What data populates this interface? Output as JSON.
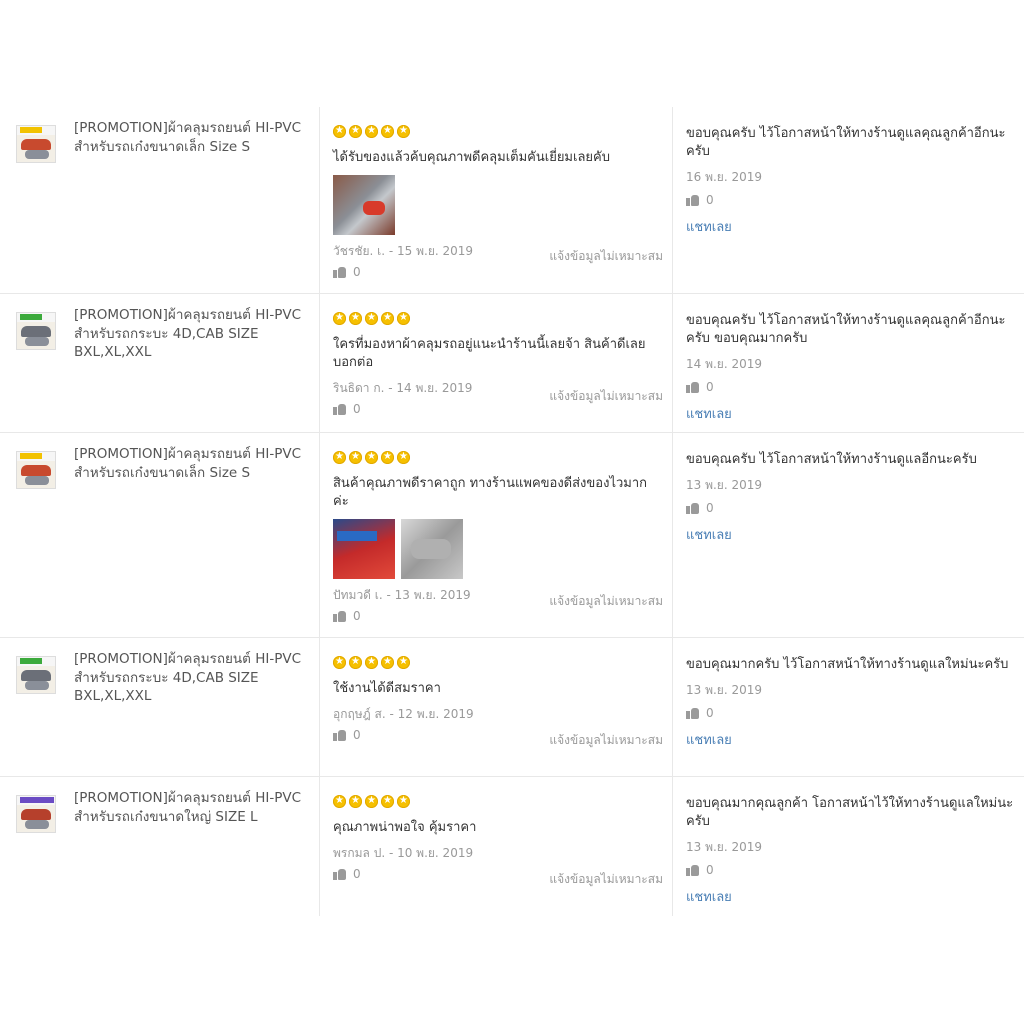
{
  "report_label": "แจ้งข้อมูลไม่เหมาะสม",
  "chat_label": "แชทเลย",
  "colors": {
    "star": "#f6c000",
    "link": "#4a7fb5",
    "muted": "#999999",
    "border": "#e8e8e8"
  },
  "reviews": [
    {
      "product_title": "[PROMOTION]ผ้าคลุมรถยนต์ HI-PVC สำหรับรถเก๋งขนาดเล็ก Size S",
      "rating": 5,
      "text": "ได้รับของแล้วค้บคุณภาพดีคลุมเต็มคันเยี่ยมเลยคับ",
      "photos": 1,
      "author_date": "วัชรชัย. เ. - 15 พ.ย. 2019",
      "likes": "0",
      "reply": "ขอบคุณครับ ไว้โอกาสหน้าให้ทางร้านดูแลคุณลูกค้าอีกนะครับ",
      "reply_date": "16 พ.ย. 2019",
      "reply_likes": "0"
    },
    {
      "product_title": "[PROMOTION]ผ้าคลุมรถยนต์ HI-PVC สำหรับรถกระบะ 4D,CAB SIZE BXL,XL,XXL",
      "rating": 5,
      "text": "ใครที่มองหาผ้าคลุมรถอยู่แนะนำร้านนี้เลยจ้า สินค้าดีเลยบอกต่อ",
      "photos": 0,
      "author_date": "รินธิดา ก. - 14 พ.ย. 2019",
      "likes": "0",
      "reply": "ขอบคุณครับ ไว้โอกาสหน้าให้ทางร้านดูแลคุณลูกค้าอีกนะครับ ขอบคุณมากครับ",
      "reply_date": "14 พ.ย. 2019",
      "reply_likes": "0"
    },
    {
      "product_title": "[PROMOTION]ผ้าคลุมรถยนต์ HI-PVC สำหรับรถเก๋งขนาดเล็ก Size S",
      "rating": 5,
      "text": "สินค้าคุณภาพดีราคาถูก ทางร้านแพคของดีส่งของไวมากค่ะ",
      "photos": 2,
      "author_date": "ปัทมวดี เ. - 13 พ.ย. 2019",
      "likes": "0",
      "reply": "ขอบคุณครับ ไว้โอกาสหน้าให้ทางร้านดูแลอีกนะครับ",
      "reply_date": "13 พ.ย. 2019",
      "reply_likes": "0"
    },
    {
      "product_title": "[PROMOTION]ผ้าคลุมรถยนต์ HI-PVC สำหรับรถกระบะ 4D,CAB SIZE BXL,XL,XXL",
      "rating": 5,
      "text": "ใช้งานได้ดีสมราคา",
      "photos": 0,
      "author_date": "อุกฤษฎ์ ส. - 12 พ.ย. 2019",
      "likes": "0",
      "reply": "ขอบคุณมากครับ ไว้โอกาสหน้าให้ทางร้านดูแลใหม่นะครับ",
      "reply_date": "13 พ.ย. 2019",
      "reply_likes": "0"
    },
    {
      "product_title": "[PROMOTION]ผ้าคลุมรถยนต์ HI-PVC สำหรับรถเก๋งขนาดใหญ่ SIZE L",
      "rating": 5,
      "text": "คุณภาพน่าพอใจ คุ้มราคา",
      "photos": 0,
      "author_date": "พรกมล ป. - 10 พ.ย. 2019",
      "likes": "0",
      "reply": "ขอบคุณมากคุณลูกค้า โอกาสหน้าไว้ให้ทางร้านดูแลใหม่นะครับ",
      "reply_date": "13 พ.ย. 2019",
      "reply_likes": "0"
    }
  ]
}
